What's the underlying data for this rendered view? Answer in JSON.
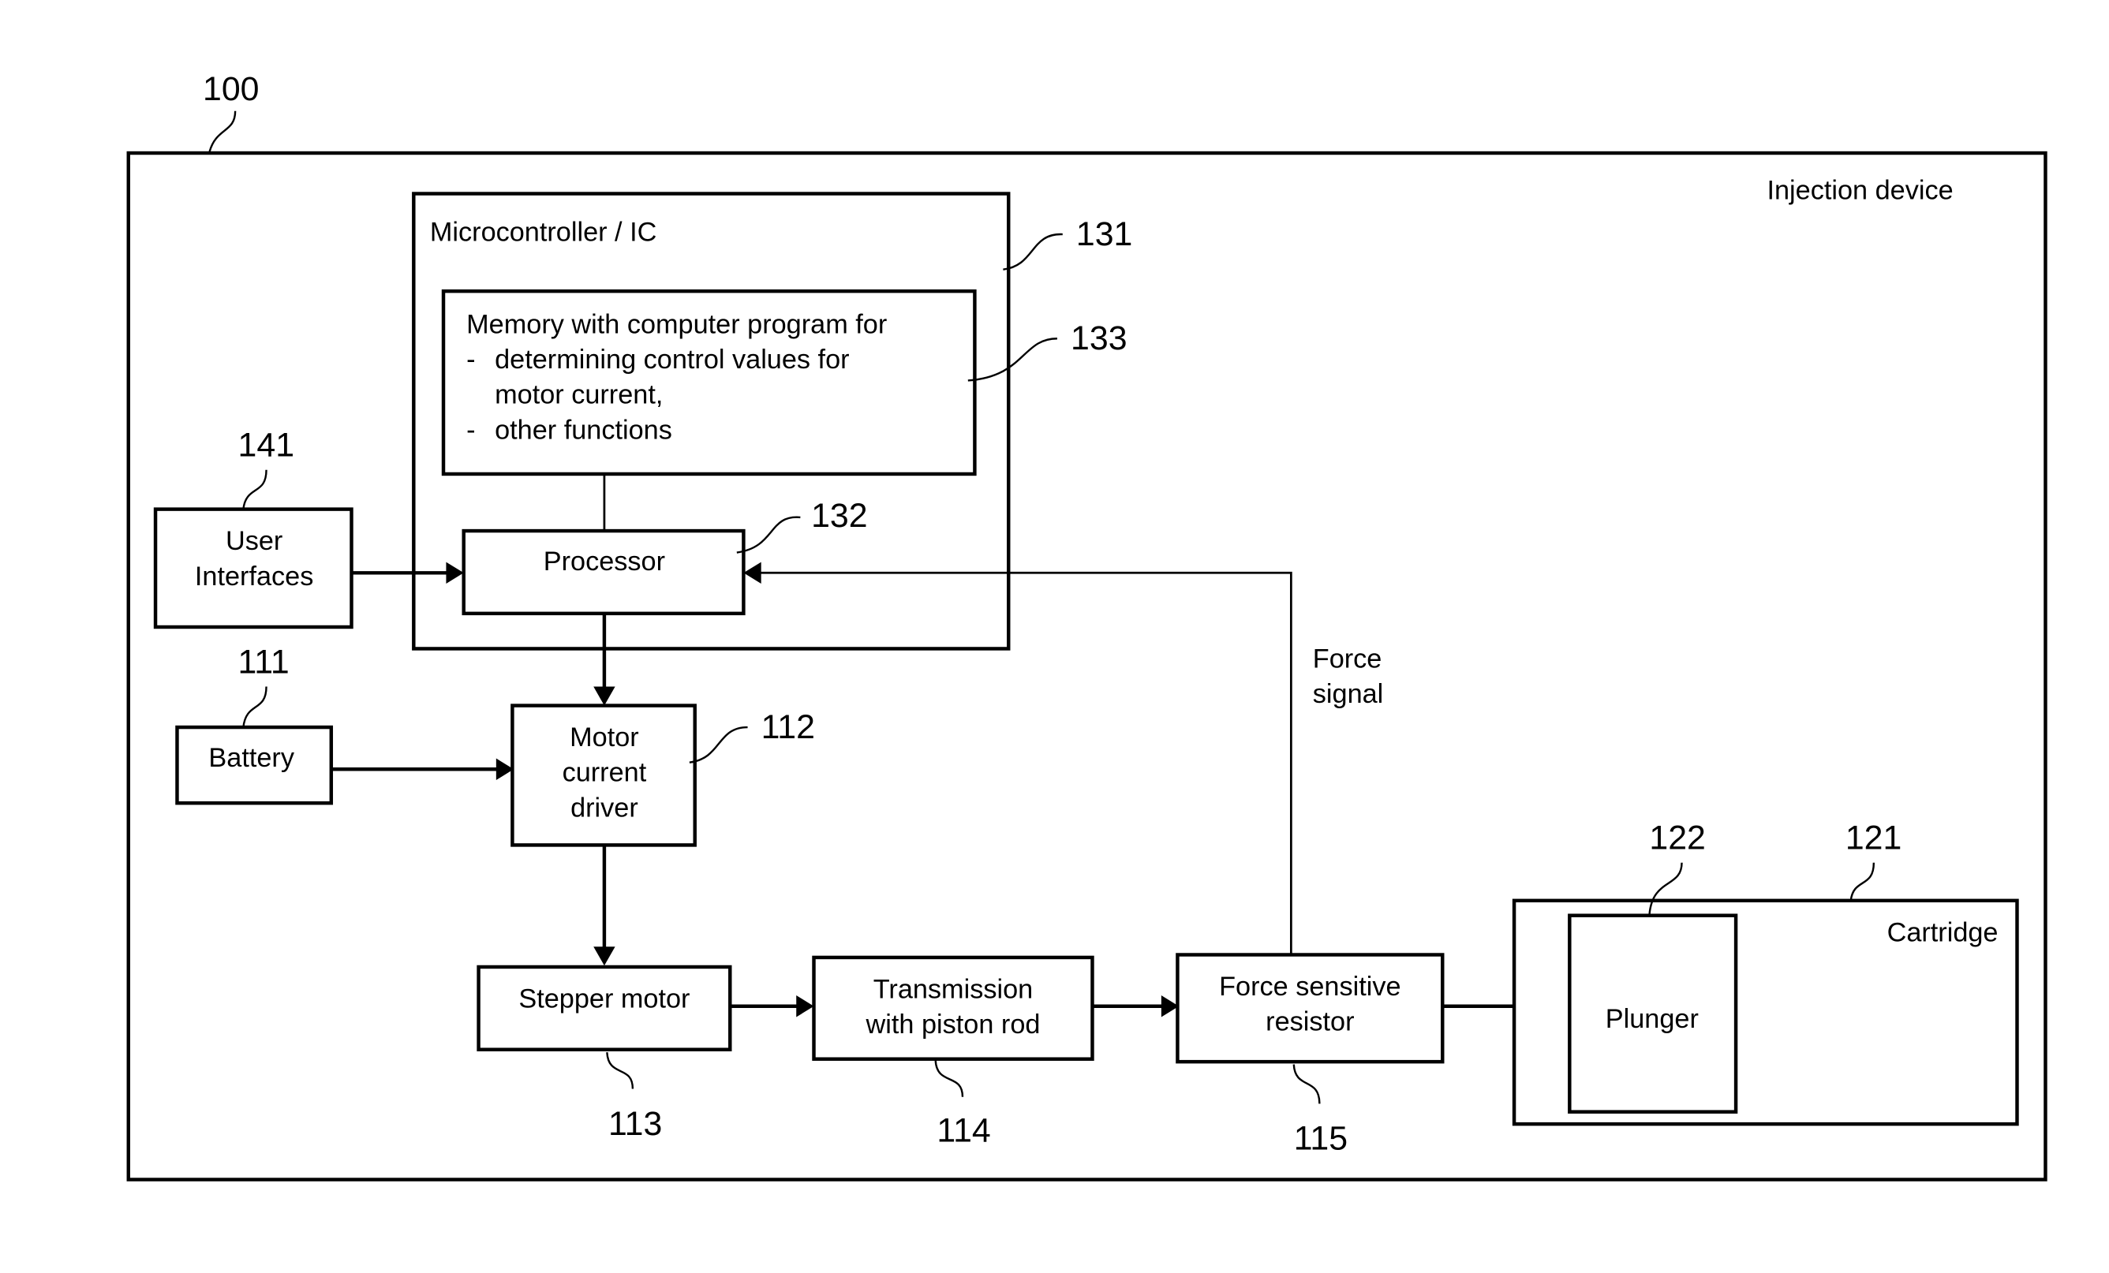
{
  "diagram": {
    "title": "Injection device",
    "reference_numbers": {
      "device": "100",
      "battery": "111",
      "motor_current_driver": "112",
      "stepper_motor": "113",
      "transmission": "114",
      "force_sensor": "115",
      "cartridge": "121",
      "plunger": "122",
      "microcontroller": "131",
      "processor": "132",
      "memory": "133",
      "user_interfaces": "141"
    },
    "blocks": {
      "microcontroller": {
        "label": "Microcontroller / IC"
      },
      "memory": {
        "lines": [
          "Memory with computer program for",
          "-",
          "determining control values for",
          "motor current,",
          "-",
          "other functions"
        ]
      },
      "processor": {
        "label": "Processor"
      },
      "user_interfaces": {
        "lines": [
          "User",
          "Interfaces"
        ]
      },
      "battery": {
        "label": "Battery"
      },
      "motor_current_driver": {
        "lines": [
          "Motor",
          "current",
          "driver"
        ]
      },
      "stepper_motor": {
        "label": "Stepper motor"
      },
      "transmission": {
        "lines": [
          "Transmission",
          "with piston rod"
        ]
      },
      "force_sensor": {
        "lines": [
          "Force sensitive",
          "resistor"
        ]
      },
      "cartridge": {
        "label": "Cartridge"
      },
      "plunger": {
        "label": "Plunger"
      }
    },
    "connections": {
      "force_signal": {
        "lines": [
          "Force",
          "signal"
        ]
      }
    }
  }
}
